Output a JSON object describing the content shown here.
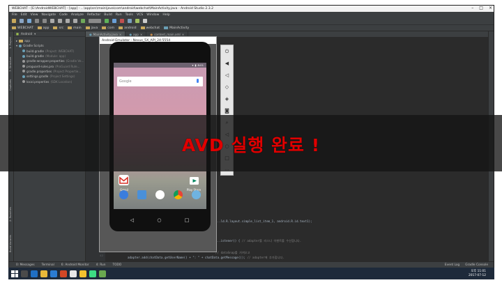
{
  "window": {
    "title": "WEBCHAT - [E:\\AndroidWEBCHAT] - [app] - ...\\app\\src\\main\\java\\com\\android\\webchat\\MainActivity.java - Android Studio 2.3.2"
  },
  "menu": [
    "File",
    "Edit",
    "View",
    "Navigate",
    "Code",
    "Analyze",
    "Refactor",
    "Build",
    "Run",
    "Tools",
    "VCS",
    "Window",
    "Help"
  ],
  "breadcrumb": [
    "WEBCHAT",
    "app",
    "src",
    "main",
    "java",
    "com",
    "android",
    "webchat",
    "MainActivity"
  ],
  "project_panel": {
    "selector": "Android",
    "items": [
      {
        "label": "app",
        "hint": ""
      },
      {
        "label": "Gradle Scripts",
        "hint": ""
      },
      {
        "label": "build.gradle",
        "hint": "(Project: WEBCHAT)"
      },
      {
        "label": "build.gradle",
        "hint": "(Module: app)"
      },
      {
        "label": "gradle-wrapper.properties",
        "hint": "(Gradle Ve..."
      },
      {
        "label": "proguard-rules.pro",
        "hint": "(ProGuard Rule..."
      },
      {
        "label": "gradle.properties",
        "hint": "(Project Propertie..."
      },
      {
        "label": "settings.gradle",
        "hint": "(Project Settings)"
      },
      {
        "label": "local.properties",
        "hint": "(SDK Location)"
      }
    ]
  },
  "editor_tabs": [
    "MainActivity.java",
    "app",
    "content_main.xml"
  ],
  "code_lines": [
    {
      "text": "...ld.R.layout.simple_list_item_1, android.R.id.text1);",
      "comment": ""
    },
    {
      "text": "...istener() {",
      "comment": "// adapter를 리스너 이벤트를 수신합니다."
    },
    {
      "text": "",
      "comment": "// dataSnap를 가져오고"
    },
    {
      "text": "adapter.add(chatData.getUserName() + \": \" + chatData.getMessage());",
      "comment": "// adapter에 추가합니다."
    }
  ],
  "emulator": {
    "title": "Android Emulator - Nexus_5X_API_24:5554",
    "clock": "8:01",
    "search_label": "Google",
    "apps": [
      {
        "label": "Gmail",
        "color": "#ffffff"
      },
      {
        "label": "Play Store",
        "color": "#ffffff"
      }
    ],
    "dock_colors": [
      "#3b7ddd",
      "#4a90d9",
      "#ffffff",
      "#e84335",
      "#6fb3e0"
    ]
  },
  "side_panel_icons": [
    "power-icon",
    "volume-up-icon",
    "volume-down-icon",
    "rotate-left-icon",
    "rotate-right-icon",
    "camera-icon",
    "zoom-icon",
    "back-icon",
    "circle-icon",
    "square-icon",
    "more-icon"
  ],
  "overlay": {
    "text": "AVD 실행 완료 !",
    "color": "#e00000"
  },
  "bottom_tools": {
    "left": [
      "0: Messages",
      "Terminal",
      "6: Android Monitor",
      "4: Run",
      "TODO"
    ],
    "right": [
      "Event Log",
      "Gradle Console"
    ]
  },
  "status": {
    "message": "Gradle build finished in 14s 856ms (moments ago)",
    "position": "33:14",
    "line_sep": "CRLF",
    "encoding": "UTF-8",
    "context": "Context: <no context>"
  },
  "taskbar": {
    "time": "오후 11:01",
    "date": "2017-07-12"
  }
}
